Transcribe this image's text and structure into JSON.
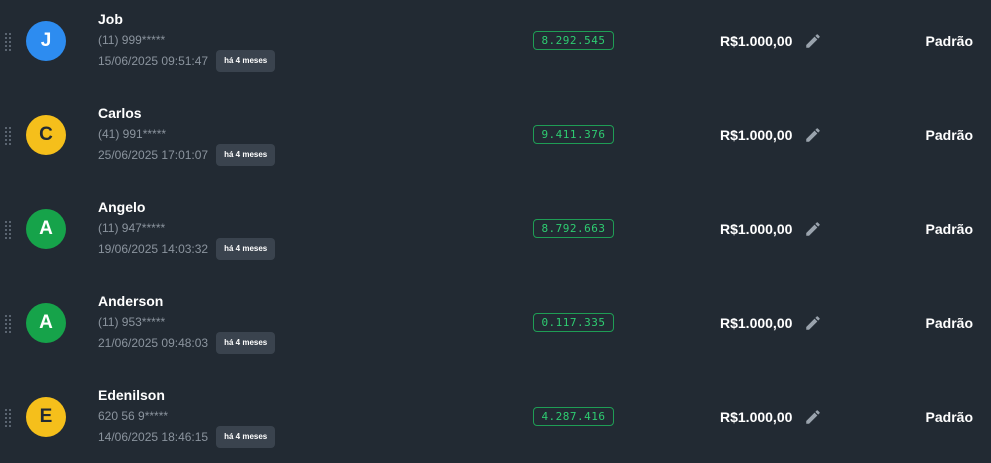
{
  "colors": {
    "background": "#222a33",
    "avatar_blue": "#2d8cf0",
    "avatar_yellow": "#f5bf1b",
    "avatar_green": "#16a34a",
    "code_green": "#2ecc71",
    "muted_text": "#8b949e"
  },
  "rows": [
    {
      "initial": "J",
      "avatar_color": "#2d8cf0",
      "name": "Job",
      "phone": "(11) 999*****",
      "datetime": "15/06/2025 09:51:47",
      "relative": "há 4 meses",
      "code": "8.292.545",
      "amount": "R$1.000,00",
      "edit_icon": "pencil-icon",
      "plan": "Padrão"
    },
    {
      "initial": "C",
      "avatar_color": "#f5bf1b",
      "name": "Carlos",
      "phone": "(41) 991*****",
      "datetime": "25/06/2025 17:01:07",
      "relative": "há 4 meses",
      "code": "9.411.376",
      "amount": "R$1.000,00",
      "edit_icon": "pencil-icon",
      "plan": "Padrão"
    },
    {
      "initial": "A",
      "avatar_color": "#16a34a",
      "name": "Angelo",
      "phone": "(11) 947*****",
      "datetime": "19/06/2025 14:03:32",
      "relative": "há 4 meses",
      "code": "8.792.663",
      "amount": "R$1.000,00",
      "edit_icon": "pencil-icon",
      "plan": "Padrão"
    },
    {
      "initial": "A",
      "avatar_color": "#16a34a",
      "name": "Anderson",
      "phone": "(11) 953*****",
      "datetime": "21/06/2025 09:48:03",
      "relative": "há 4 meses",
      "code": "0.117.335",
      "amount": "R$1.000,00",
      "edit_icon": "pencil-icon",
      "plan": "Padrão"
    },
    {
      "initial": "E",
      "avatar_color": "#f5bf1b",
      "name": "Edenilson",
      "phone": "620 56 9*****",
      "datetime": "14/06/2025 18:46:15",
      "relative": "há 4 meses",
      "code": "4.287.416",
      "amount": "R$1.000,00",
      "edit_icon": "pencil-icon",
      "plan": "Padrão"
    }
  ]
}
